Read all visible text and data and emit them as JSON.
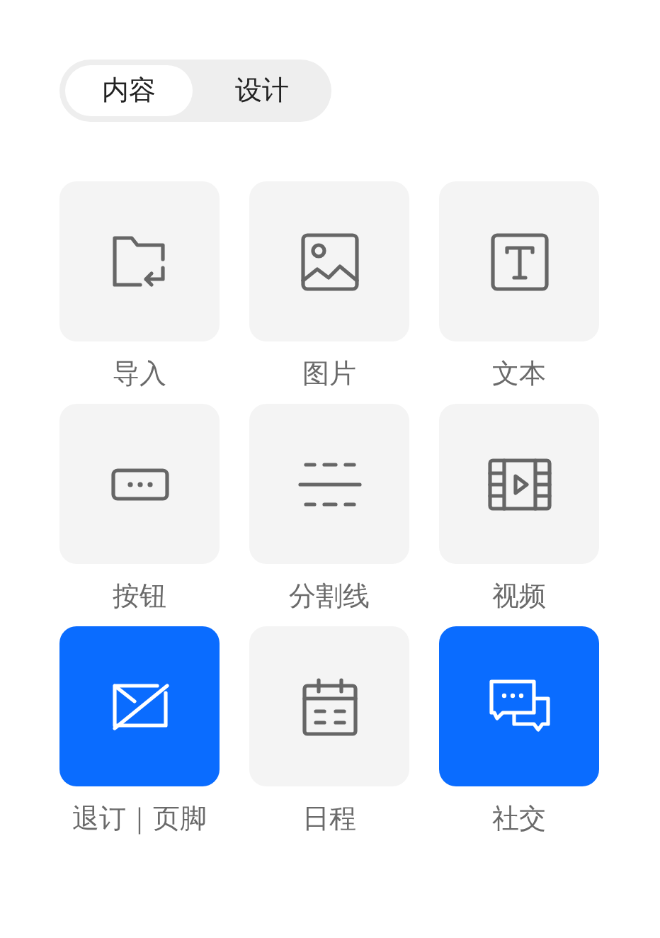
{
  "tabs": [
    {
      "label": "内容",
      "selected": true
    },
    {
      "label": "设计",
      "selected": false
    }
  ],
  "blocks": [
    {
      "kind": "import",
      "label": "导入",
      "selected": false
    },
    {
      "kind": "image",
      "label": "图片",
      "selected": false
    },
    {
      "kind": "text",
      "label": "文本",
      "selected": false
    },
    {
      "kind": "button",
      "label": "按钮",
      "selected": false
    },
    {
      "kind": "divider",
      "label": "分割线",
      "selected": false
    },
    {
      "kind": "video",
      "label": "视频",
      "selected": false
    },
    {
      "kind": "unsubscribe",
      "label": "退订｜页脚",
      "selected": true
    },
    {
      "kind": "schedule",
      "label": "日程",
      "selected": false
    },
    {
      "kind": "social",
      "label": "社交",
      "selected": true
    }
  ]
}
